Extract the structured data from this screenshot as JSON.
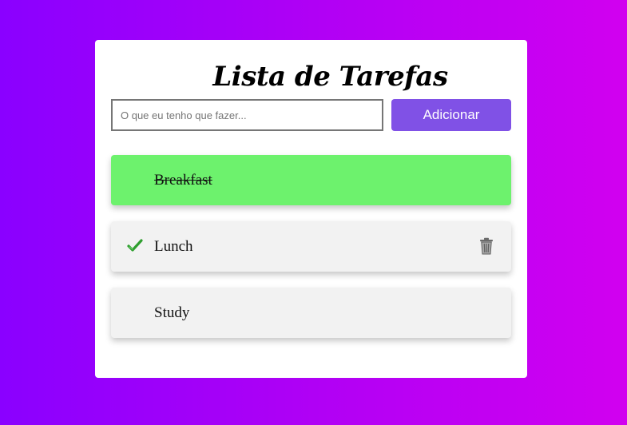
{
  "app": {
    "title": "Lista de Tarefas"
  },
  "form": {
    "input_placeholder": "O que eu tenho que fazer...",
    "input_value": "",
    "add_label": "Adicionar"
  },
  "tasks": [
    {
      "label": "Breakfast",
      "completed": true
    },
    {
      "label": "Lunch",
      "completed": false,
      "hovered": true
    },
    {
      "label": "Study",
      "completed": false
    }
  ],
  "colors": {
    "background_start": "#8a00ff",
    "background_end": "#d100f0",
    "button": "#8051e6",
    "completed_task": "#6df26d",
    "task": "#f2f2f2"
  },
  "icons": {
    "check": "check-icon",
    "trash": "trash-icon"
  }
}
